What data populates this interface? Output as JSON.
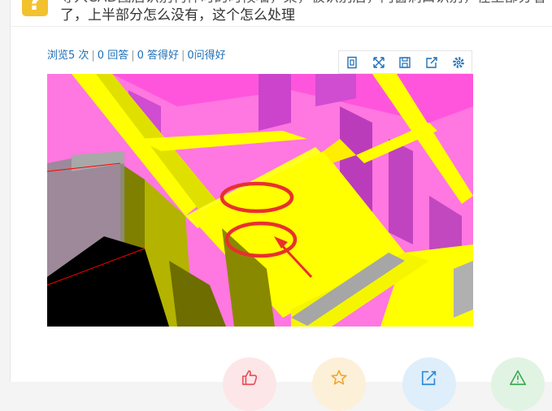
{
  "question": {
    "title_line1": "导入CAD图后识别构件时的时候墙，梁，板识别后，门窗洞口识别，在上部分看不见了",
    "title_line2": "了，上半部分怎么没有，这个怎么处理"
  },
  "stats": {
    "views": "浏览5 次",
    "answers": "0 回答",
    "good_answers": "0 答得好",
    "good_questions": "0问得好"
  },
  "image_tools": [
    {
      "name": "original-size-icon"
    },
    {
      "name": "fullscreen-icon"
    },
    {
      "name": "save-icon"
    },
    {
      "name": "share-icon"
    },
    {
      "name": "gear-icon"
    }
  ],
  "actions": [
    {
      "name": "thumbs-up-icon",
      "color": "#e8505b"
    },
    {
      "name": "star-icon",
      "color": "#f0a830"
    },
    {
      "name": "edit-share-icon",
      "color": "#2d8ad8"
    },
    {
      "name": "warning-icon",
      "color": "#3aaa55"
    }
  ],
  "colors": {
    "accent_link": "#1e6fb5",
    "question_icon": "#f2c12e",
    "annotation_red": "#e8302e",
    "model_magenta": "#ff66dd",
    "model_yellow": "#ffff00"
  }
}
